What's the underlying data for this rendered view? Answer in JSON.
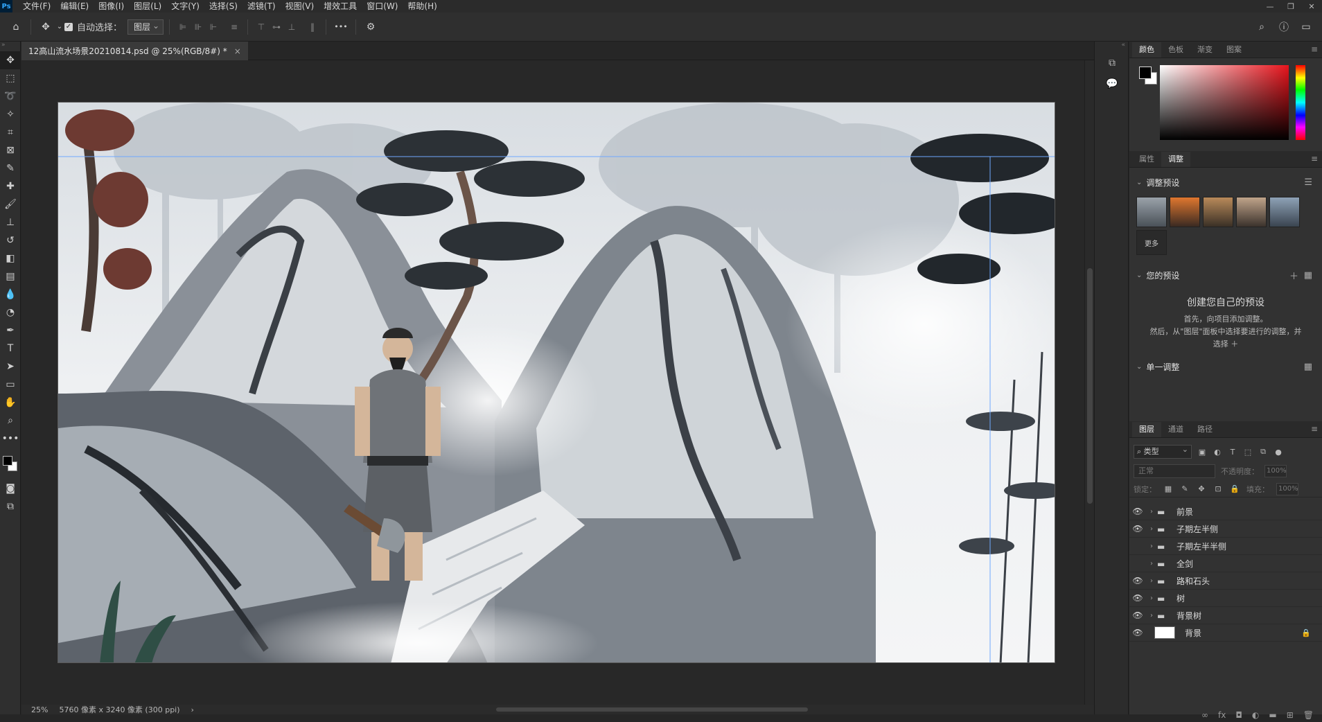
{
  "menubar": {
    "logo": "Ps",
    "items": [
      "文件(F)",
      "编辑(E)",
      "图像(I)",
      "图层(L)",
      "文字(Y)",
      "选择(S)",
      "滤镜(T)",
      "视图(V)",
      "增效工具",
      "窗口(W)",
      "帮助(H)"
    ],
    "window_controls": [
      "—",
      "❐",
      "✕"
    ]
  },
  "options": {
    "auto_select_label": "自动选择：",
    "auto_select_checked": true,
    "auto_select_target": "图层",
    "more": "•••"
  },
  "document": {
    "tab_title": "12高山流水场景20210814.psd @ 25%(RGB/8#) *",
    "close": "×"
  },
  "status": {
    "zoom": "25%",
    "doc_info": "5760 像素 x 3240 像素 (300 ppi)",
    "arrow": "›"
  },
  "color_panel": {
    "tabs": [
      "颜色",
      "色板",
      "渐变",
      "图案"
    ],
    "active_tab": "颜色",
    "foreground": "#000000",
    "background": "#ffffff"
  },
  "adjust_panel": {
    "tabs": [
      "属性",
      "调整"
    ],
    "active_tab": "调整",
    "presets_section": "调整预设",
    "more_label": "更多",
    "your_presets_section": "您的预设",
    "create_title": "创建您自己的预设",
    "create_desc_1": "首先，向项目添加调整。",
    "create_desc_2": "然后，从\"图层\"面板中选择要进行的调整，并",
    "create_desc_3": "选择 ＋",
    "single_section": "单一调整"
  },
  "layers_panel": {
    "tabs": [
      "图层",
      "通道",
      "路径"
    ],
    "active_tab": "图层",
    "filter_label": "类型",
    "blend_mode": "正常",
    "opacity_label": "不透明度：",
    "opacity_value": "100%",
    "lock_label": "锁定：",
    "fill_label": "填充：",
    "fill_value": "100%",
    "layers": [
      {
        "name": "前景",
        "visible": true,
        "type": "group"
      },
      {
        "name": "子期左半侧",
        "visible": true,
        "type": "group"
      },
      {
        "name": "子期左半半侧",
        "visible": false,
        "type": "group"
      },
      {
        "name": "全剑",
        "visible": false,
        "type": "group"
      },
      {
        "name": "路和石头",
        "visible": true,
        "type": "group"
      },
      {
        "name": "树",
        "visible": true,
        "type": "group"
      },
      {
        "name": "背景树",
        "visible": true,
        "type": "group"
      },
      {
        "name": "背景",
        "visible": true,
        "type": "pixel",
        "locked": true
      }
    ]
  },
  "colors": {
    "accent": "#31a8ff",
    "panel_bg": "#323232"
  }
}
